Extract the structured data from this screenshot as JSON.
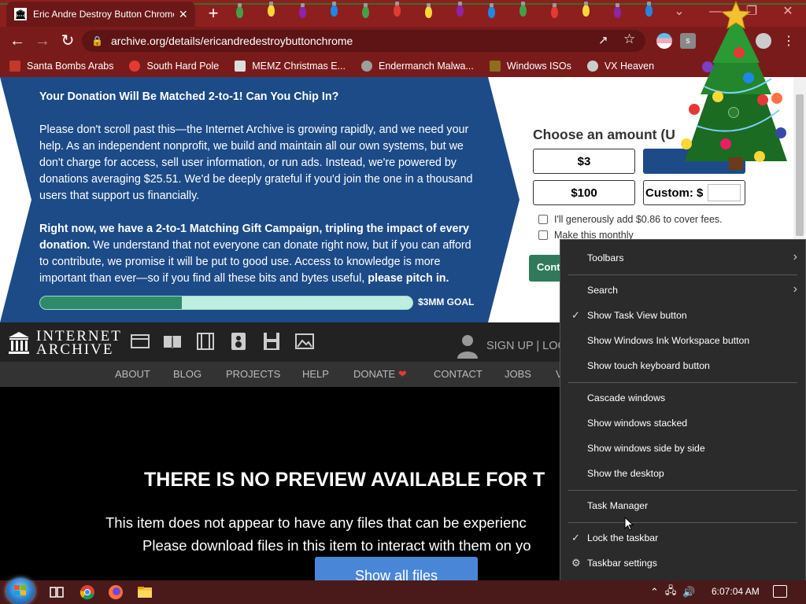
{
  "browser": {
    "tab_title": "Eric Andre Destroy Button Chrome",
    "tab_close": "×",
    "new_tab": "+",
    "url": "archive.org/details/ericandredestroybuttonchrome",
    "bookmarks": [
      {
        "label": "Santa Bombs Arabs",
        "icon_color": "#c0392b"
      },
      {
        "label": "South Hard Pole",
        "icon_color": "#e53935"
      },
      {
        "label": "MEMZ Christmas E...",
        "icon_color": "#dddddd"
      },
      {
        "label": "Endermanch Malwa...",
        "icon_color": "#9e9e9e"
      },
      {
        "label": "Windows ISOs",
        "icon_color": "#8d6e1e"
      },
      {
        "label": "VX Heaven",
        "icon_color": "#cccccc"
      }
    ]
  },
  "donation": {
    "heading": "Your Donation Will Be Matched 2-to-1! Can You Chip In?",
    "para1": "Please don't scroll past this—the Internet Archive is growing rapidly, and we need your help. As an independent nonprofit, we build and maintain all our own systems, but we don't charge for access, sell user information, or run ads. Instead, we're powered by donations averaging $25.51. We'd be deeply grateful if you'd join the one in a thousand users that support us financially.",
    "para2_bold": "Right now, we have a 2-to-1 Matching Gift Campaign, tripling the impact of every donation.",
    "para2_text": " We understand that not everyone can donate right now, but if you can afford to contribute, we promise it will be put to good use. Access to knowledge is more important than ever—so if you find all these bits and bytes useful, ",
    "para2_end": "please pitch in.",
    "progress_fraction": 0.38,
    "goal_label": "$3MM GOAL",
    "choose_label": "Choose an amount (U",
    "amount_3": "$3",
    "amount_100": "$100",
    "custom_label": "Custom: $",
    "fees_label": "I'll generously add $0.86 to cover fees.",
    "monthly_label": "Make this monthly",
    "continue_label": "Conti"
  },
  "ia": {
    "logo_line1": "INTERNET",
    "logo_line2": "ARCHIVE",
    "signup": "SIGN UP | LOG",
    "nav": [
      "ABOUT",
      "BLOG",
      "PROJECTS",
      "HELP",
      "DONATE",
      "CONTACT",
      "JOBS",
      "V"
    ]
  },
  "content": {
    "no_preview": "THERE IS NO PREVIEW AVAILABLE FOR T",
    "desc_line1": "This item does not appear to have any files that can be experienc",
    "desc_line2": "Please download files in this item to interact with them on yo",
    "show_all": "Show all files"
  },
  "context_menu": {
    "items": [
      {
        "label": "Toolbars",
        "checked": false,
        "submenu": true
      },
      {
        "label": "Search",
        "checked": false,
        "submenu": true
      },
      {
        "label": "Show Task View button",
        "checked": true,
        "submenu": false
      },
      {
        "label": "Show Windows Ink Workspace button",
        "checked": false,
        "submenu": false
      },
      {
        "label": "Show touch keyboard button",
        "checked": false,
        "submenu": false
      },
      {
        "label": "Cascade windows",
        "checked": false,
        "submenu": false
      },
      {
        "label": "Show windows stacked",
        "checked": false,
        "submenu": false
      },
      {
        "label": "Show windows side by side",
        "checked": false,
        "submenu": false
      },
      {
        "label": "Show the desktop",
        "checked": false,
        "submenu": false
      },
      {
        "label": "Task Manager",
        "checked": false,
        "submenu": false
      },
      {
        "label": "Lock the taskbar",
        "checked": true,
        "submenu": false
      },
      {
        "label": "Taskbar settings",
        "checked": false,
        "submenu": false,
        "icon": "gear-icon"
      }
    ]
  },
  "taskbar": {
    "clock": "6:07:04 AM",
    "pinned": [
      "task-view-icon",
      "chrome-icon",
      "firefox-icon",
      "file-explorer-icon"
    ]
  },
  "colors": {
    "banner_blue": "#1d4b88",
    "progress_fill": "#2e8a6b",
    "progress_track": "#bdeee0",
    "continue_green": "#2f7a5b"
  }
}
